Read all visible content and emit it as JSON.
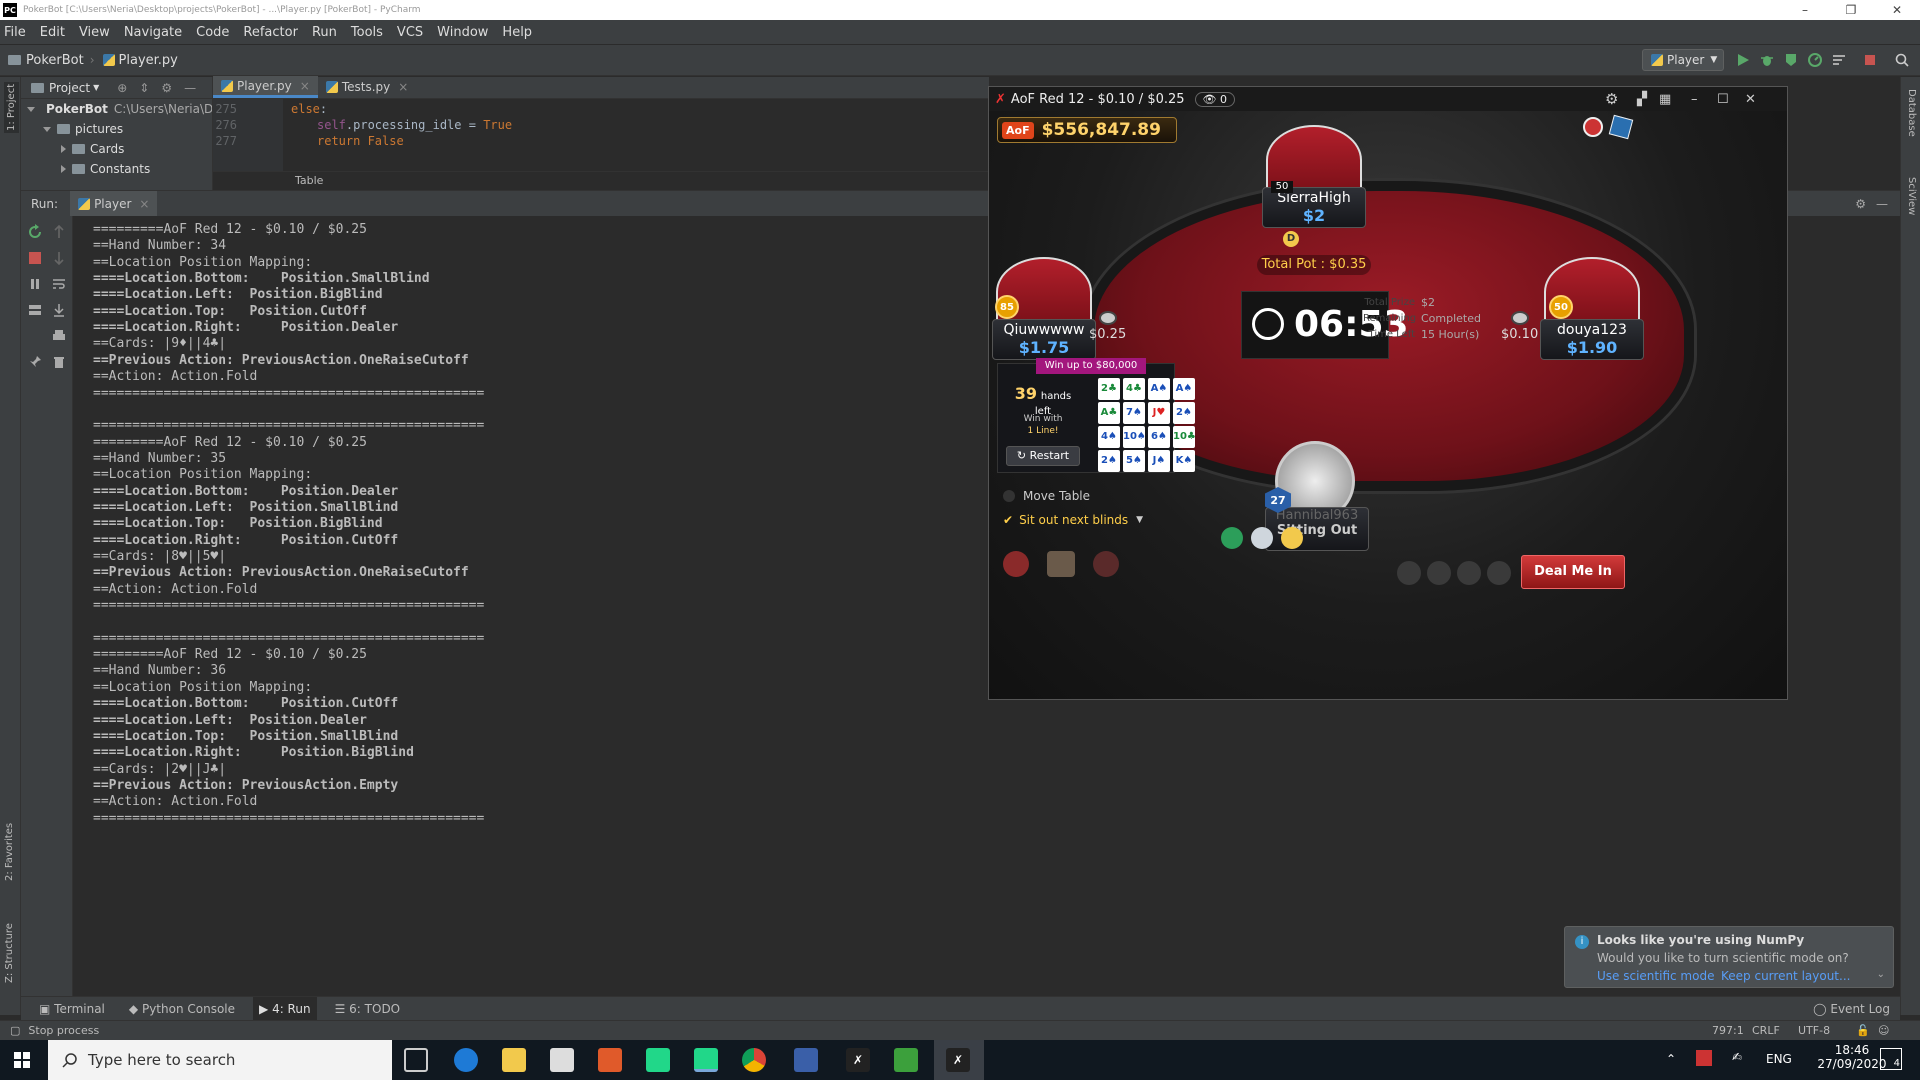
{
  "window": {
    "title": "PokerBot [C:\\Users\\Neria\\Desktop\\projects\\PokerBot] - ...\\Player.py [PokerBot] - PyCharm",
    "app_icon": "PC"
  },
  "menu": [
    "File",
    "Edit",
    "View",
    "Navigate",
    "Code",
    "Refactor",
    "Run",
    "Tools",
    "VCS",
    "Window",
    "Help"
  ],
  "navbar": {
    "project": "PokerBot",
    "file": "Player.py",
    "run_config": "Player"
  },
  "left_strip": {
    "project": "1: Project",
    "favorites": "2: Favorites",
    "structure": "Z: Structure"
  },
  "right_strip": {
    "database": "Database",
    "sciview": "SciView"
  },
  "project_panel": {
    "header": "Project",
    "tree": [
      {
        "label": "PokerBot",
        "path": "C:\\Users\\Neria\\De"
      },
      {
        "label": "pictures"
      },
      {
        "label": "Cards"
      },
      {
        "label": "Constants"
      }
    ]
  },
  "editor": {
    "tabs": [
      "Player.py",
      "Tests.py"
    ],
    "lines": [
      {
        "num": "275",
        "parts": [
          {
            "t": "else",
            "c": "kw"
          },
          {
            "t": ":",
            "c": "plain"
          }
        ]
      },
      {
        "num": "276",
        "parts": [
          {
            "t": "self",
            "c": "self"
          },
          {
            "t": ".processing_idle = ",
            "c": "plain"
          },
          {
            "t": "True",
            "c": "kw"
          }
        ]
      },
      {
        "num": "277",
        "parts": [
          {
            "t": "return ",
            "c": "kw"
          },
          {
            "t": "False",
            "c": "kw"
          }
        ]
      }
    ],
    "breadcrumb": "Table"
  },
  "run_panel": {
    "label": "Run:",
    "tab": "Player",
    "output": [
      {
        "t": "=========AoF Red 12 - $0.10 / $0.25",
        "b": false
      },
      {
        "t": "==Hand Number: 34",
        "b": false
      },
      {
        "t": "==Location Position Mapping:",
        "b": false
      },
      {
        "t": "====Location.Bottom:    Position.SmallBlind",
        "b": true
      },
      {
        "t": "====Location.Left:  Position.BigBlind",
        "b": true
      },
      {
        "t": "====Location.Top:   Position.CutOff",
        "b": true
      },
      {
        "t": "====Location.Right:     Position.Dealer",
        "b": true
      },
      {
        "t": "==Cards: |9♦||4♣|",
        "b": false
      },
      {
        "t": "==Previous Action: PreviousAction.OneRaiseCutoff",
        "b": true
      },
      {
        "t": "==Action: Action.Fold",
        "b": false
      },
      {
        "t": "==================================================",
        "b": false
      },
      {
        "t": "",
        "b": false
      },
      {
        "t": "==================================================",
        "b": false
      },
      {
        "t": "=========AoF Red 12 - $0.10 / $0.25",
        "b": false
      },
      {
        "t": "==Hand Number: 35",
        "b": false
      },
      {
        "t": "==Location Position Mapping:",
        "b": false
      },
      {
        "t": "====Location.Bottom:    Position.Dealer",
        "b": true
      },
      {
        "t": "====Location.Left:  Position.SmallBlind",
        "b": true
      },
      {
        "t": "====Location.Top:   Position.BigBlind",
        "b": true
      },
      {
        "t": "====Location.Right:     Position.CutOff",
        "b": true
      },
      {
        "t": "==Cards: |8♥||5♥|",
        "b": false
      },
      {
        "t": "==Previous Action: PreviousAction.OneRaiseCutoff",
        "b": true
      },
      {
        "t": "==Action: Action.Fold",
        "b": false
      },
      {
        "t": "==================================================",
        "b": false
      },
      {
        "t": "",
        "b": false
      },
      {
        "t": "==================================================",
        "b": false
      },
      {
        "t": "=========AoF Red 12 - $0.10 / $0.25",
        "b": false
      },
      {
        "t": "==Hand Number: 36",
        "b": false
      },
      {
        "t": "==Location Position Mapping:",
        "b": false
      },
      {
        "t": "====Location.Bottom:    Position.CutOff",
        "b": true
      },
      {
        "t": "====Location.Left:  Position.Dealer",
        "b": true
      },
      {
        "t": "====Location.Top:   Position.SmallBlind",
        "b": true
      },
      {
        "t": "====Location.Right:     Position.BigBlind",
        "b": true
      },
      {
        "t": "==Cards: |2♥||J♣|",
        "b": false
      },
      {
        "t": "==Previous Action: PreviousAction.Empty",
        "b": true
      },
      {
        "t": "==Action: Action.Fold",
        "b": false
      },
      {
        "t": "==================================================",
        "b": false
      }
    ]
  },
  "bottom_tabs": [
    "Terminal",
    "Python Console",
    "4: Run",
    "6: TODO"
  ],
  "event_log": "Event Log",
  "status": {
    "left": "Stop process",
    "pos": "797:1",
    "eol": "CRLF",
    "enc": "UTF-8"
  },
  "notification": {
    "title": "Looks like you're using NumPy",
    "body": "Would you like to turn scientific mode on?",
    "link1": "Use scientific mode",
    "link2": "Keep current layout..."
  },
  "poker": {
    "title": "AoF Red 12 - $0.10 / $0.25",
    "observers": "0",
    "balance": "$556,847.89",
    "total_pot": "Total Pot : $0.35",
    "timer": "06:53",
    "prize_labels": [
      "Total Prize",
      "Remaining",
      "Time Left"
    ],
    "prize_values": [
      "$2",
      "Completed",
      "15 Hour(s)"
    ],
    "seats": {
      "top": {
        "name": "SierraHigh",
        "stack": "$2",
        "level": "50"
      },
      "left": {
        "name": "Qiuwwwww",
        "stack": "$1.75",
        "level": "85"
      },
      "right": {
        "name": "douya123",
        "stack": "$1.90",
        "level": "50"
      },
      "bottom": {
        "name": "Hannibal963",
        "stack": "Sitting Out",
        "level": "27"
      }
    },
    "chips": {
      "left": "$0.25",
      "right": "$0.10"
    },
    "dealer_button": "D",
    "promo": {
      "banner": "Win up to $80,000",
      "hands_num": "39",
      "hands_text": "hands left",
      "win_with": "Win with",
      "one_line": "1 Line!",
      "restart": "Restart",
      "grid": [
        "2♣",
        "4♣",
        "A♠",
        "A♠",
        "A♣",
        "7♠",
        "J♥",
        "2♠",
        "4♠",
        "10♠",
        "6♠",
        "10♣",
        "2♠",
        "5♠",
        "J♠",
        "K♠"
      ]
    },
    "move_table": "Move Table",
    "sit_out": "Sit out next blinds",
    "deal_me_in": "Deal Me In"
  },
  "taskbar": {
    "search": "Type here to search",
    "lang": "ENG",
    "time": "18:46",
    "date": "27/09/2020",
    "notif_count": "4"
  },
  "colors": {
    "ide_bg": "#2b2b2b",
    "panel": "#3c3f41",
    "poker_red": "#8e1620",
    "stack_blue": "#5fb3ff",
    "accent": "#4a88c7"
  }
}
